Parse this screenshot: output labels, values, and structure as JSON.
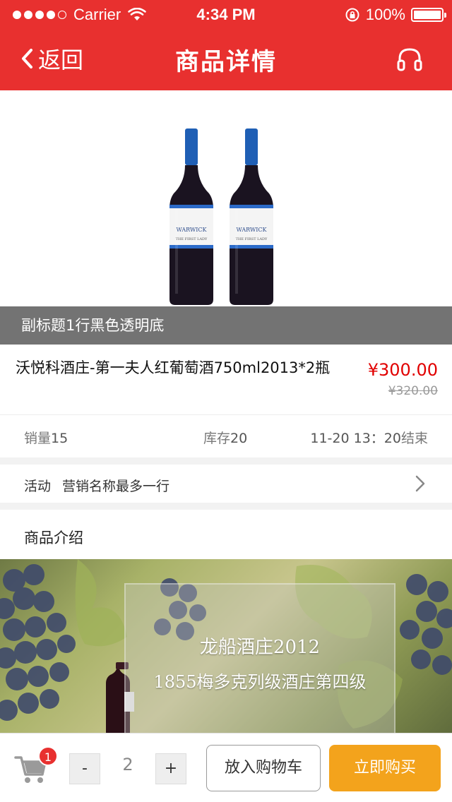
{
  "status_bar": {
    "carrier": "Carrier",
    "time": "4:34 PM",
    "battery": "100%"
  },
  "nav": {
    "back_label": "返回",
    "title": "商品详情",
    "service_icon": "headset-icon"
  },
  "product": {
    "bottle_label_brand": "WARWICK",
    "bottle_label_line": "THE FIRST LADY",
    "subtitle": "副标题1行黑色透明底",
    "name": "沃悦科酒庄-第一夫人红葡萄酒750ml2013*2瓶",
    "price": "¥300.00",
    "original_price": "¥320.00"
  },
  "stats": {
    "sales_label": "销量",
    "sales_value": "15",
    "stock_label": "库存",
    "stock_value": "20",
    "end_time": "11-20 13：20",
    "end_label": "结束"
  },
  "activity": {
    "label": "活动",
    "value": "营销名称最多一行"
  },
  "intro": {
    "title": "商品介绍",
    "line1": "龙船酒庄2012",
    "line2": "1855梅多克列级酒庄第四级"
  },
  "bottom_bar": {
    "cart_badge": "1",
    "minus_label": "-",
    "quantity": "2",
    "plus_label": "+",
    "add_to_cart_label": "放入购物车",
    "buy_now_label": "立即购买"
  },
  "colors": {
    "header": "#e8302f",
    "price": "#e10000",
    "buy_button": "#f3a31c"
  }
}
